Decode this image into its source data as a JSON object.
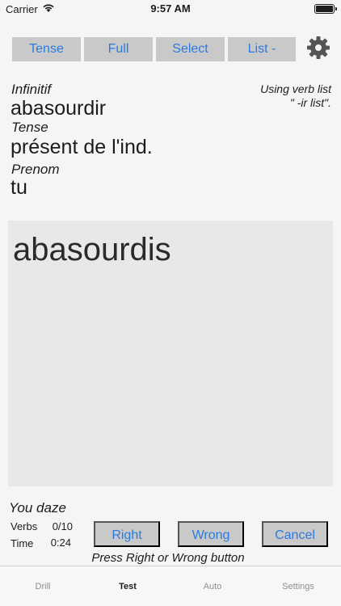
{
  "status_bar": {
    "carrier": "Carrier",
    "time": "9:57 AM"
  },
  "toolbar": {
    "tense_label": "Tense",
    "full_label": "Full",
    "select_label": "Select",
    "list_label": "List -"
  },
  "quiz": {
    "infinitif_label": "Infinitif",
    "infinitif_value": "abasourdir",
    "tense_label": "Tense",
    "tense_value": "présent de l'ind.",
    "prenom_label": "Prenom",
    "prenom_value": "tu",
    "verb_list_line1": "Using verb list",
    "verb_list_line2": "\" -ir list\"."
  },
  "answer": {
    "text": "abasourdis"
  },
  "footer": {
    "meaning": "You daze",
    "verbs_label": "Verbs",
    "verbs_value": "0/10",
    "time_label": "Time",
    "time_value": "0:24",
    "right_label": "Right",
    "wrong_label": "Wrong",
    "cancel_label": "Cancel",
    "hint": "Press Right or Wrong button"
  },
  "tabs": [
    {
      "label": "Drill",
      "active": false
    },
    {
      "label": "Test",
      "active": true
    },
    {
      "label": "Auto",
      "active": false
    },
    {
      "label": "Settings",
      "active": false
    }
  ],
  "colors": {
    "accent": "#2a7be0",
    "button_bg": "#c9c9c9",
    "answer_bg": "#e8e8e8"
  },
  "icons": {
    "settings": "gear-icon",
    "wifi": "wifi-icon",
    "battery": "battery-icon"
  }
}
